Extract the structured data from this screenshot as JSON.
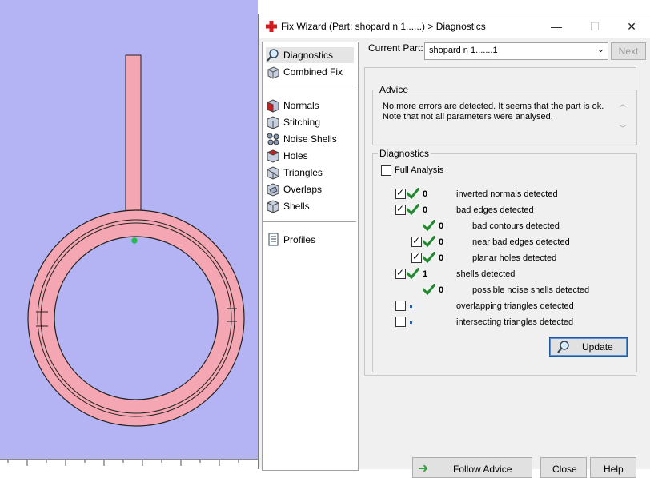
{
  "window": {
    "title": "Fix Wizard (Part: shopard n 1......) > Diagnostics",
    "minimize_label": "—",
    "maximize_label": "☐",
    "close_label": "✕"
  },
  "nav": {
    "items": [
      {
        "label": "Diagnostics",
        "icon": "magnifier-icon"
      },
      {
        "label": "Combined Fix",
        "icon": "combined-fix-icon"
      },
      {
        "label": "Normals",
        "icon": "normals-cube-icon"
      },
      {
        "label": "Stitching",
        "icon": "stitching-icon"
      },
      {
        "label": "Noise Shells",
        "icon": "noise-shells-icon"
      },
      {
        "label": "Holes",
        "icon": "holes-icon"
      },
      {
        "label": "Triangles",
        "icon": "triangles-icon"
      },
      {
        "label": "Overlaps",
        "icon": "overlaps-icon"
      },
      {
        "label": "Shells",
        "icon": "shells-icon"
      },
      {
        "label": "Profiles",
        "icon": "profiles-icon"
      }
    ]
  },
  "current_part": {
    "label": "Current Part:",
    "value": "shopard n 1.......1",
    "next_label": "Next"
  },
  "advice": {
    "title": "Advice",
    "line1": "No more errors are detected. It seems that the part is ok.",
    "line2": "Note that not all parameters were analysed."
  },
  "diagnostics": {
    "title": "Diagnostics",
    "full_analysis_label": "Full Analysis",
    "full_analysis_checked": false,
    "rows": [
      {
        "checked": true,
        "count": "0",
        "label": "inverted normals detected",
        "status": "ok"
      },
      {
        "checked": true,
        "count": "0",
        "label": "bad edges detected",
        "status": "ok"
      },
      {
        "checked": null,
        "count": "0",
        "label": "bad contours detected",
        "status": "ok"
      },
      {
        "checked": true,
        "count": "0",
        "label": "near bad edges detected",
        "status": "ok"
      },
      {
        "checked": true,
        "count": "0",
        "label": "planar holes detected",
        "status": "ok"
      },
      {
        "checked": true,
        "count": "1",
        "label": "shells detected",
        "status": "ok"
      },
      {
        "checked": null,
        "count": "0",
        "label": "possible noise shells detected",
        "status": "ok"
      },
      {
        "checked": false,
        "count": "",
        "label": "overlapping triangles detected",
        "status": "unknown"
      },
      {
        "checked": false,
        "count": "",
        "label": "intersecting triangles detected",
        "status": "unknown"
      }
    ],
    "update_label": "Update"
  },
  "footer": {
    "follow_advice_label": "Follow Advice",
    "close_label": "Close",
    "help_label": "Help"
  },
  "colors": {
    "viewport_bg": "#b4b4f4",
    "model": "#f4a7b2",
    "tick_green": "#1f8a2e",
    "accent_blue": "#1e5aa8"
  }
}
